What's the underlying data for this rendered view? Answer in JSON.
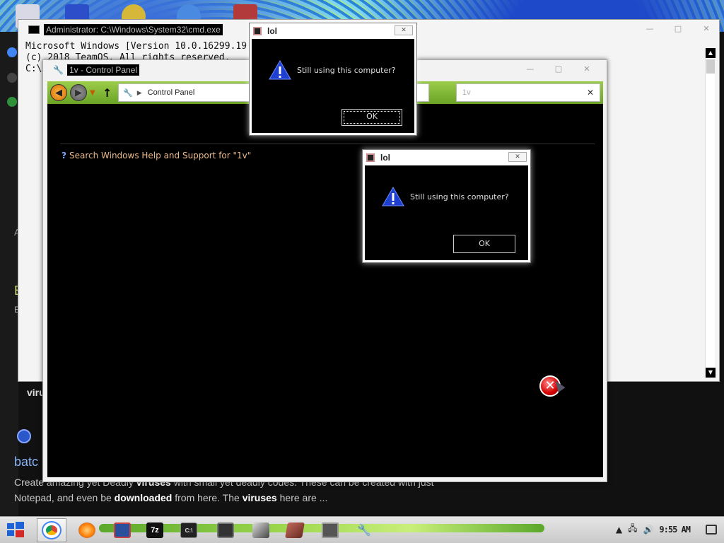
{
  "cmd": {
    "title": "Administrator: C:\\Windows\\System32\\cmd.exe",
    "lines": [
      "Microsoft Windows [Version 10.0.16299.19",
      "(c) 2018 TeamOS. All rights reserved.",
      "",
      "C:\\"
    ]
  },
  "control_panel": {
    "title": "1v - Control Panel",
    "address": "Control Panel",
    "search_value": "1v",
    "help_link": "Search Windows Help and Support for \"1v\""
  },
  "dialogs": [
    {
      "title": "lol",
      "message": "Still using this computer?",
      "ok_label": "OK"
    },
    {
      "title": "lol",
      "message": "Still using this computer?",
      "ok_label": "OK"
    }
  ],
  "browser": {
    "result_title": "batc",
    "result_snippet_1_pre": "Create amazing yet Deadly ",
    "result_snippet_1_bold": "viruses",
    "result_snippet_1_post": " with small yet deadly codes. These can be created with just",
    "result_snippet_2_pre": "Notepad, and even be ",
    "result_snippet_2_bold": "downloaded",
    "result_snippet_2_mid": " from here. The ",
    "result_snippet_2_bold2": "viruses",
    "result_snippet_2_post": " here are ...",
    "partial_word": "viru",
    "side_letters": [
      "A",
      "E",
      "E"
    ]
  },
  "taskbar": {
    "clock": "9:55 AM",
    "items": [
      "chrome-icon",
      "firefox-icon",
      "app-icon",
      "7zip-icon",
      "cmd-icon",
      "monitor-icon",
      "cube-icon",
      "book-icon",
      "camera-icon",
      "wrench-icon"
    ],
    "sevenzip_label": "7z",
    "cmd_label": "C:\\"
  }
}
